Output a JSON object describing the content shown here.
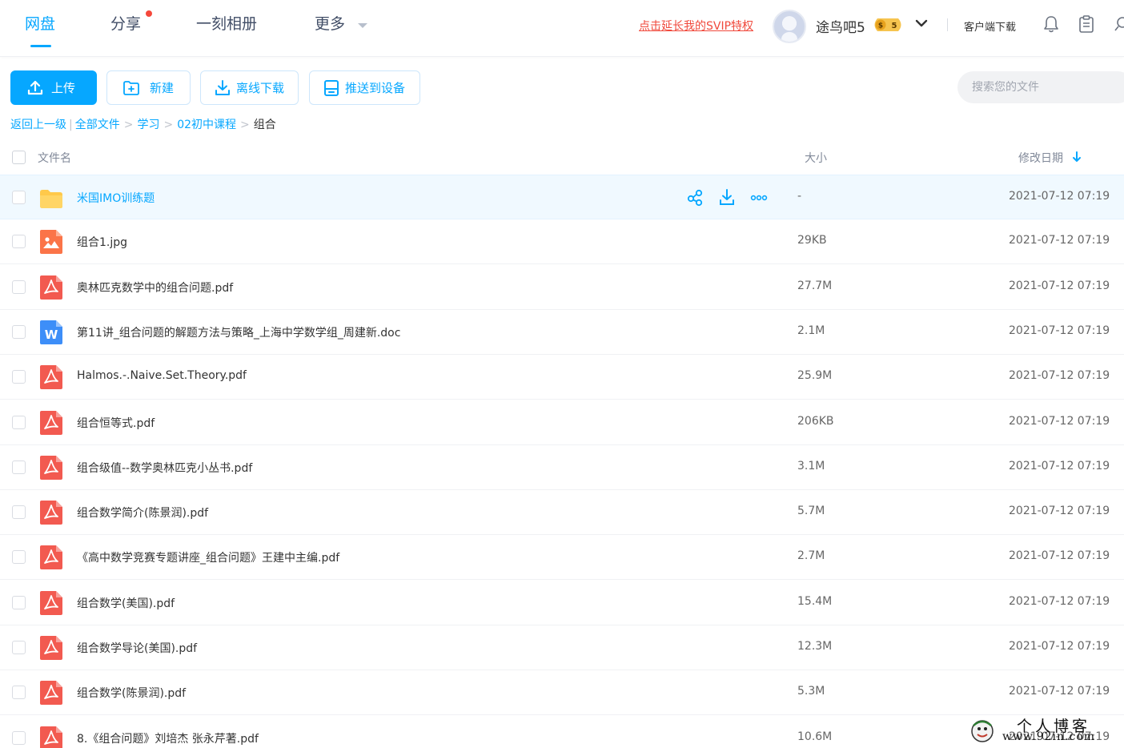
{
  "nav": {
    "tabs": [
      {
        "label": "网盘",
        "active": true
      },
      {
        "label": "分享",
        "has_dot": true
      },
      {
        "label": "一刻相册"
      },
      {
        "label": "更多"
      }
    ],
    "svip_link": "点击延长我的SVIP特权",
    "username": "途鸟吧5",
    "vip_badge_level": "5",
    "client_download": "客户端下载"
  },
  "toolbar": {
    "upload": "上传",
    "new": "新建",
    "offline_download": "离线下载",
    "push_to_device": "推送到设备",
    "search_placeholder": "搜索您的文件"
  },
  "breadcrumb": {
    "back": "返回上一级",
    "items": [
      "全部文件",
      "学习",
      "02初中课程"
    ],
    "current": "组合"
  },
  "table": {
    "columns": {
      "name": "文件名",
      "size": "大小",
      "modified": "修改日期"
    },
    "sort": {
      "column": "modified",
      "direction": "desc"
    },
    "rows": [
      {
        "name": "米国IMO训练题",
        "type": "folder",
        "size": "-",
        "modified": "2021-07-12 07:19",
        "hovered": true
      },
      {
        "name": "组合1.jpg",
        "type": "image",
        "size": "29KB",
        "modified": "2021-07-12 07:19"
      },
      {
        "name": "奥林匹克数学中的组合问题.pdf",
        "type": "pdf",
        "size": "27.7M",
        "modified": "2021-07-12 07:19"
      },
      {
        "name": "第11讲_组合问题的解题方法与策略_上海中学数学组_周建新.doc",
        "type": "word",
        "size": "2.1M",
        "modified": "2021-07-12 07:19"
      },
      {
        "name": "Halmos.-.Naive.Set.Theory.pdf",
        "type": "pdf",
        "size": "25.9M",
        "modified": "2021-07-12 07:19"
      },
      {
        "name": "组合恒等式.pdf",
        "type": "pdf",
        "size": "206KB",
        "modified": "2021-07-12 07:19"
      },
      {
        "name": "组合级值--数学奥林匹克小丛书.pdf",
        "type": "pdf",
        "size": "3.1M",
        "modified": "2021-07-12 07:19"
      },
      {
        "name": "组合数学简介(陈景润).pdf",
        "type": "pdf",
        "size": "5.7M",
        "modified": "2021-07-12 07:19"
      },
      {
        "name": "《高中数学竞赛专题讲座_组合问题》王建中主编.pdf",
        "type": "pdf",
        "size": "2.7M",
        "modified": "2021-07-12 07:19"
      },
      {
        "name": "组合数学(美国).pdf",
        "type": "pdf",
        "size": "15.4M",
        "modified": "2021-07-12 07:19"
      },
      {
        "name": "组合数学导论(美国).pdf",
        "type": "pdf",
        "size": "12.3M",
        "modified": "2021-07-12 07:19"
      },
      {
        "name": "组合数学(陈景润).pdf",
        "type": "pdf",
        "size": "5.3M",
        "modified": "2021-07-12 07:19"
      },
      {
        "name": "8.《组合问题》刘培杰 张永芹著.pdf",
        "type": "pdf",
        "size": "10.6M",
        "modified": "2021-07-12 07:19"
      }
    ]
  },
  "watermark": {
    "title": "个人博客",
    "url": "www.92in.com"
  },
  "colors": {
    "accent": "#06a7ff",
    "svip_red": "#f0493c",
    "pdf_red": "#f25a50",
    "folder_yellow": "#ffc94a",
    "word_blue": "#3d8ef8",
    "image_orange": "#fb7448"
  }
}
